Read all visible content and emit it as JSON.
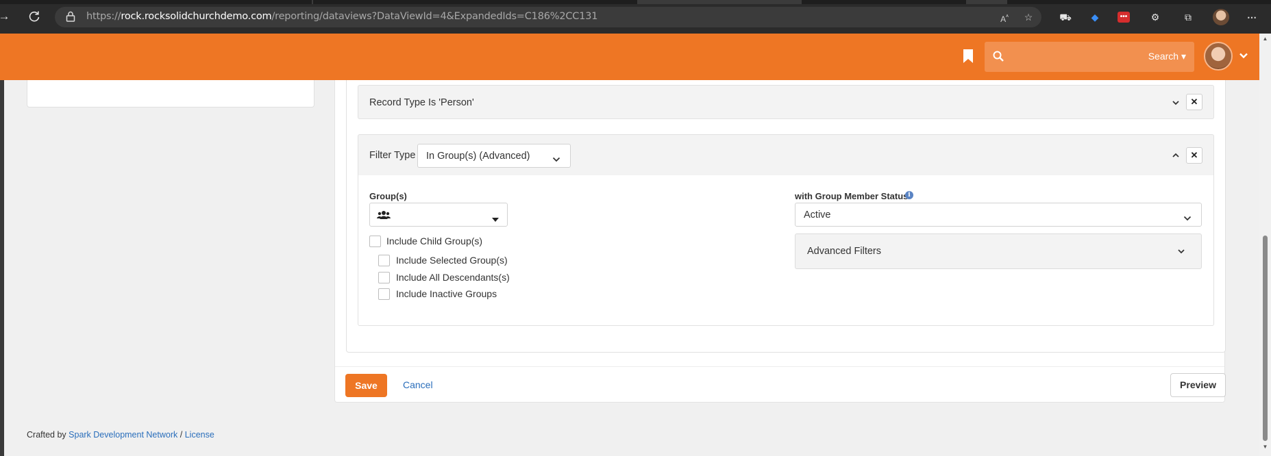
{
  "browser": {
    "url_prefix": "https://",
    "url_host": "rock.rocksolidchurchdemo.com",
    "url_path": "/reporting/dataviews?DataViewId=4&ExpandedIds=C186%2CC131"
  },
  "header": {
    "search_label": "Search ▾"
  },
  "filters": {
    "record_type_title": "Record Type Is 'Person'",
    "filter_type_label": "Filter Type",
    "filter_type_value": "In Group(s) (Advanced)",
    "groups_label": "Group(s)",
    "include_child_groups": "Include Child Group(s)",
    "include_selected_groups": "Include Selected Group(s)",
    "include_all_descendants": "Include All Descendants(s)",
    "include_inactive_groups": "Include Inactive Groups",
    "member_status_label": "with Group Member Status",
    "member_status_value": "Active",
    "advanced_filters_label": "Advanced Filters"
  },
  "actions": {
    "save": "Save",
    "cancel": "Cancel",
    "preview": "Preview"
  },
  "footer": {
    "crafted_by": "Crafted by",
    "spark_link": "Spark Development Network",
    "separator": "/",
    "license_link": "License"
  },
  "colors": {
    "brand_orange": "#ee7624",
    "link_blue": "#2a6ebb"
  }
}
